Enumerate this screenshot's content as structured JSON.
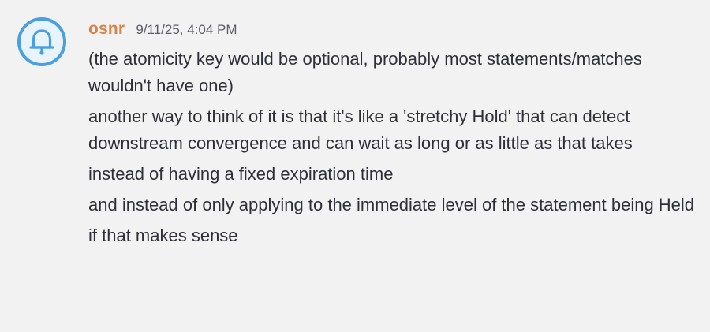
{
  "author": {
    "name": "osnr",
    "avatar_icon": "bell-icon",
    "avatar_color": "#4a9fe0"
  },
  "timestamp": "9/11/25, 4:04 PM",
  "messages": [
    "(the atomicity key would be optional, probably most statements/matches wouldn't have one)",
    "another way to think of it is that it's like a 'stretchy Hold' that can detect downstream convergence and can wait as long or as little as that takes",
    "instead of having a fixed expiration time",
    "and instead of only applying to the immediate level  of the statement being Held",
    "if that makes sense"
  ]
}
